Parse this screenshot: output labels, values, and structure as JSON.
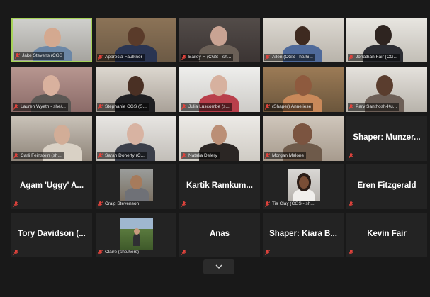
{
  "participants": [
    {
      "name": "Jake Stevens (CGS",
      "display": ""
    },
    {
      "name": "Apprecia Faulkner",
      "display": ""
    },
    {
      "name": "Bailey H (CGS - sh...",
      "display": ""
    },
    {
      "name": "Allen (CGS - he/hi...",
      "display": ""
    },
    {
      "name": "Jonathan Fair (CG...",
      "display": ""
    },
    {
      "name": "Lauren Wyeth - she/...",
      "display": ""
    },
    {
      "name": "Stephanie CGS (S...",
      "display": ""
    },
    {
      "name": "Julia Luscombe (s...",
      "display": ""
    },
    {
      "name": "(Shaper) Anneliese",
      "display": ""
    },
    {
      "name": "Parv Santhosh-Ku...",
      "display": ""
    },
    {
      "name": "Carli Feinstein (sh...",
      "display": ""
    },
    {
      "name": "Sarah Doherty (C...",
      "display": ""
    },
    {
      "name": "Natalia Delery",
      "display": ""
    },
    {
      "name": "Morgan Malone",
      "display": ""
    },
    {
      "name": "",
      "display": "Shaper: Munzer..."
    },
    {
      "name": "",
      "display": "Agam 'Uggy' A..."
    },
    {
      "name": "Craig Stevenson",
      "display": ""
    },
    {
      "name": "",
      "display": "Kartik Ramkum..."
    },
    {
      "name": "Tia Clay (CGS - sh...",
      "display": ""
    },
    {
      "name": "",
      "display": "Eren Fitzgerald"
    },
    {
      "name": "",
      "display": "Tory Davidson (..."
    },
    {
      "name": "Claire (she/hers)",
      "display": ""
    },
    {
      "name": "",
      "display": "Anas"
    },
    {
      "name": "",
      "display": "Shaper: Kiara B..."
    },
    {
      "name": "",
      "display": "Kevin Fair"
    }
  ],
  "colors": {
    "muted_mic": "#e0433c",
    "active_speaker_border": "#a7d35a"
  },
  "icons": {
    "mic": "mic-muted-icon",
    "expand": "chevron-down-icon"
  }
}
